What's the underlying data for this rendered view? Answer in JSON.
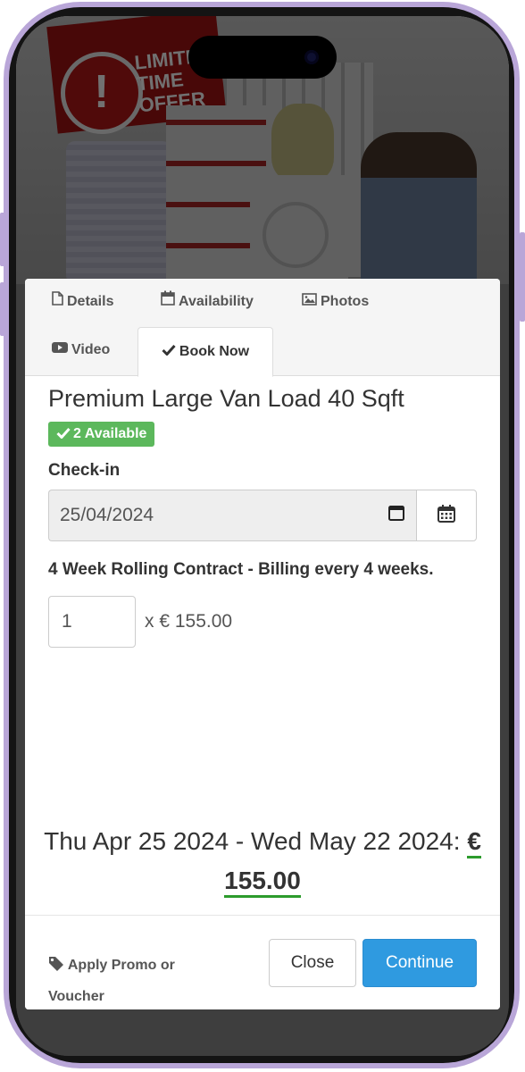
{
  "hero": {
    "sign_text": "LIMITED TIME OFFER"
  },
  "tabs": [
    {
      "label": "Details",
      "icon": "file-icon"
    },
    {
      "label": "Availability",
      "icon": "calendar-icon"
    },
    {
      "label": "Photos",
      "icon": "image-icon"
    },
    {
      "label": "Video",
      "icon": "youtube-play-icon"
    },
    {
      "label": "Book Now",
      "icon": "check-icon",
      "active": true
    }
  ],
  "booking": {
    "title": "Premium Large Van Load 40 Sqft",
    "availability_badge": "2 Available",
    "checkin_label": "Check-in",
    "checkin_value": "25/04/2024",
    "contract_text": "4 Week Rolling Contract - Billing every 4 weeks.",
    "quantity": "1",
    "unit_price": "x € 155.00",
    "date_range": "Thu Apr 25 2024 - Wed May 22 2024:",
    "total": "€ 155.00"
  },
  "footer": {
    "promo_label": "Apply Promo or Voucher",
    "close_label": "Close",
    "continue_label": "Continue"
  },
  "colors": {
    "badge_green": "#5cb85c",
    "continue_blue": "#2f9ae0",
    "total_underline": "#2c9b2c",
    "phone_frame": "#b9a6d8"
  }
}
